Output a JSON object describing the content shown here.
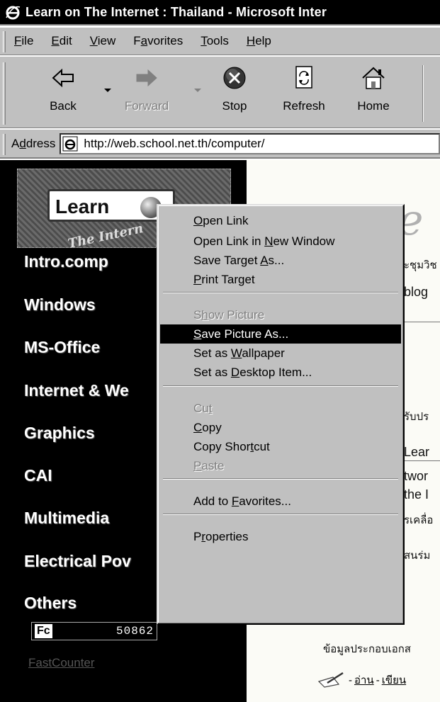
{
  "window": {
    "title": "Learn on The Internet : Thailand - Microsoft Inter"
  },
  "menubar": {
    "items": [
      {
        "pre": "",
        "u": "F",
        "post": "ile"
      },
      {
        "pre": "",
        "u": "E",
        "post": "dit"
      },
      {
        "pre": "",
        "u": "V",
        "post": "iew"
      },
      {
        "pre": "F",
        "u": "a",
        "post": "vorites"
      },
      {
        "pre": "",
        "u": "T",
        "post": "ools"
      },
      {
        "pre": "",
        "u": "H",
        "post": "elp"
      }
    ]
  },
  "toolbar": {
    "back": "Back",
    "forward": "Forward",
    "stop": "Stop",
    "refresh": "Refresh",
    "home": "Home"
  },
  "address": {
    "label_pre": "A",
    "label_u": "d",
    "label_post": "dress",
    "url": "http://web.school.net.th/computer/"
  },
  "sidebar": {
    "nav": [
      "Intro.comp",
      "Windows",
      "MS-Office",
      "Internet & We",
      "Graphics",
      "CAI",
      "Multimedia",
      "Electrical Pov",
      "Others"
    ],
    "logo_text": "Learn",
    "logo_sub": "The Intern",
    "counter_tag": "Fc",
    "counter_value": "50862",
    "fastcounter": "FastCounter"
  },
  "content": {
    "big_letter": "e",
    "frag1": "ะชุมวิช",
    "frag2": "blog",
    "frag3": "รับปร",
    "frag4": "Lear",
    "frag5": "twor",
    "frag6": "the I",
    "frag7": "รเคลื่อ",
    "frag8": "สนร่ม",
    "thai_line": "ข้อมูลประกอบเอกส",
    "read": "อ่าน",
    "write": "เขียน",
    "dash": "-"
  },
  "context_menu": {
    "items": [
      {
        "pre": "",
        "u": "O",
        "post": "pen Link",
        "state": "normal"
      },
      {
        "pre": "Open Link in ",
        "u": "N",
        "post": "ew Window",
        "state": "normal"
      },
      {
        "pre": "Save Target ",
        "u": "A",
        "post": "s...",
        "state": "normal"
      },
      {
        "pre": "",
        "u": "P",
        "post": "rint Target",
        "state": "normal"
      },
      {
        "pre": "S",
        "u": "h",
        "post": "ow Picture",
        "state": "disabled"
      },
      {
        "pre": "",
        "u": "S",
        "post": "ave Picture As...",
        "state": "selected"
      },
      {
        "pre": "Set as ",
        "u": "W",
        "post": "allpaper",
        "state": "normal"
      },
      {
        "pre": "Set as ",
        "u": "D",
        "post": "esktop Item...",
        "state": "normal"
      },
      {
        "pre": "Cu",
        "u": "t",
        "post": "",
        "state": "disabled"
      },
      {
        "pre": "",
        "u": "C",
        "post": "opy",
        "state": "normal"
      },
      {
        "pre": "Copy Shor",
        "u": "t",
        "post": "cut",
        "state": "normal"
      },
      {
        "pre": "",
        "u": "P",
        "post": "aste",
        "state": "disabled"
      },
      {
        "pre": "Add to ",
        "u": "F",
        "post": "avorites...",
        "state": "normal"
      },
      {
        "pre": "P",
        "u": "r",
        "post": "operties",
        "state": "normal"
      }
    ]
  }
}
